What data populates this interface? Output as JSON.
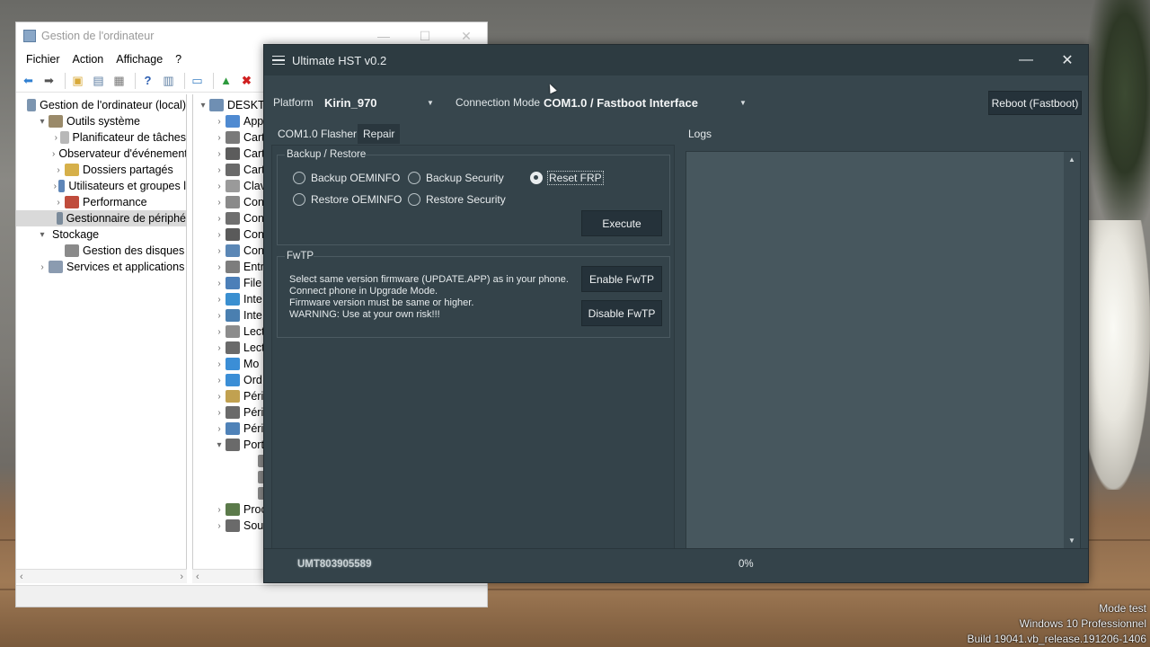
{
  "desktop": {
    "watermark_lines": [
      "Mode test",
      "Windows 10 Professionnel",
      "Build 19041.vb_release.191206-1406"
    ]
  },
  "computer_management": {
    "title": "Gestion de l'ordinateur",
    "menu": [
      "Fichier",
      "Action",
      "Affichage",
      "?"
    ],
    "tree": [
      {
        "label": "Gestion de l'ordinateur (local)",
        "level": 0,
        "expander": "",
        "icon_color": "#7c95b0"
      },
      {
        "label": "Outils système",
        "level": 1,
        "expander": "▾",
        "icon_color": "#9a8a6a"
      },
      {
        "label": "Planificateur de tâches",
        "level": 2,
        "expander": "›",
        "icon_color": "#b8b8b8"
      },
      {
        "label": "Observateur d'événements",
        "level": 2,
        "expander": "›",
        "icon_color": "#6c8db0"
      },
      {
        "label": "Dossiers partagés",
        "level": 2,
        "expander": "›",
        "icon_color": "#d6b04a"
      },
      {
        "label": "Utilisateurs et groupes l",
        "level": 2,
        "expander": "›",
        "icon_color": "#5e86b8"
      },
      {
        "label": "Performance",
        "level": 2,
        "expander": "›",
        "icon_color": "#c04c3c"
      },
      {
        "label": "Gestionnaire de périphé",
        "level": 2,
        "expander": "",
        "icon_color": "#7b8b9b",
        "selected": true
      },
      {
        "label": "Stockage",
        "level": 1,
        "expander": "▾",
        "icon_color": ""
      },
      {
        "label": "Gestion des disques",
        "level": 2,
        "expander": "",
        "icon_color": "#8a8a8a"
      },
      {
        "label": "Services et applications",
        "level": 1,
        "expander": "›",
        "icon_color": "#8b9bb0"
      }
    ],
    "device_tree": [
      {
        "label": "DESKTO",
        "expander": "▾",
        "icon_color": "#6f8fb3"
      },
      {
        "label": "App",
        "expander": "›",
        "icon_color": "#4f8ad1"
      },
      {
        "label": "Cart",
        "expander": "›",
        "icon_color": "#7a7a7a"
      },
      {
        "label": "Cart",
        "expander": "›",
        "icon_color": "#5c5c5c"
      },
      {
        "label": "Cart",
        "expander": "›",
        "icon_color": "#6a6a6a"
      },
      {
        "label": "Clav",
        "expander": "›",
        "icon_color": "#9a9a9a"
      },
      {
        "label": "Con",
        "expander": "›",
        "icon_color": "#8a8a8a"
      },
      {
        "label": "Con",
        "expander": "›",
        "icon_color": "#6f6f6f"
      },
      {
        "label": "Con",
        "expander": "›",
        "icon_color": "#5a5a5a"
      },
      {
        "label": "Con",
        "expander": "›",
        "icon_color": "#5b87b6"
      },
      {
        "label": "Entr",
        "expander": "›",
        "icon_color": "#7d7d7d"
      },
      {
        "label": "File",
        "expander": "›",
        "icon_color": "#4c7fb8"
      },
      {
        "label": "Inte",
        "expander": "›",
        "icon_color": "#3a8fd0"
      },
      {
        "label": "Inte",
        "expander": "›",
        "icon_color": "#4a7fb0"
      },
      {
        "label": "Lect",
        "expander": "›",
        "icon_color": "#8c8c8c"
      },
      {
        "label": "Lect",
        "expander": "›",
        "icon_color": "#6a6a6a"
      },
      {
        "label": "Mo",
        "expander": "›",
        "icon_color": "#3b8ed6"
      },
      {
        "label": "Ord",
        "expander": "›",
        "icon_color": "#3b8ed6"
      },
      {
        "label": "Péri",
        "expander": "›",
        "icon_color": "#c1a150"
      },
      {
        "label": "Péri",
        "expander": "›",
        "icon_color": "#6a6a6a"
      },
      {
        "label": "Péri",
        "expander": "›",
        "icon_color": "#4f82b8"
      },
      {
        "label": "Port",
        "expander": "▾",
        "icon_color": "#6a6a6a"
      },
      {
        "label": "",
        "expander": "",
        "icon_color": "#8a8a8a"
      },
      {
        "label": "",
        "expander": "",
        "icon_color": "#8a8a8a"
      },
      {
        "label": "",
        "expander": "",
        "icon_color": "#8a8a8a"
      },
      {
        "label": "Proc",
        "expander": "›",
        "icon_color": "#5b7a4a"
      },
      {
        "label": "Sou",
        "expander": "›",
        "icon_color": "#6a6a6a"
      }
    ]
  },
  "hst": {
    "title": "Ultimate HST v0.2",
    "platform_label": "Platform",
    "platform_value": "Kirin_970",
    "connection_label": "Connection Mode",
    "connection_value": "COM1.0 / Fastboot Interface",
    "reboot_button": "Reboot (Fastboot)",
    "tabs": [
      "COM1.0 Flasher",
      "Repair"
    ],
    "logs_tab": "Logs",
    "backup_group": {
      "title": "Backup / Restore",
      "options": [
        {
          "label": "Backup OEMINFO",
          "checked": false
        },
        {
          "label": "Backup Security",
          "checked": false
        },
        {
          "label": "Reset FRP",
          "checked": true
        },
        {
          "label": "Restore OEMINFO",
          "checked": false
        },
        {
          "label": "Restore Security",
          "checked": false
        }
      ],
      "execute_button": "Execute"
    },
    "fwtp_group": {
      "title": "FwTP",
      "lines": [
        "Select same version firmware (UPDATE.APP) as in your phone.",
        "Connect phone in Upgrade Mode.",
        "Firmware version must be same or higher.",
        "WARNING: Use at your own risk!!!"
      ],
      "enable_button": "Enable FwTP",
      "disable_button": "Disable FwTP"
    },
    "status": {
      "serial": "UMT803905589",
      "progress": "0%"
    },
    "colors": {
      "window_bg": "#37464d",
      "button_bg": "#25323a",
      "logs_bg": "#47575e"
    }
  }
}
